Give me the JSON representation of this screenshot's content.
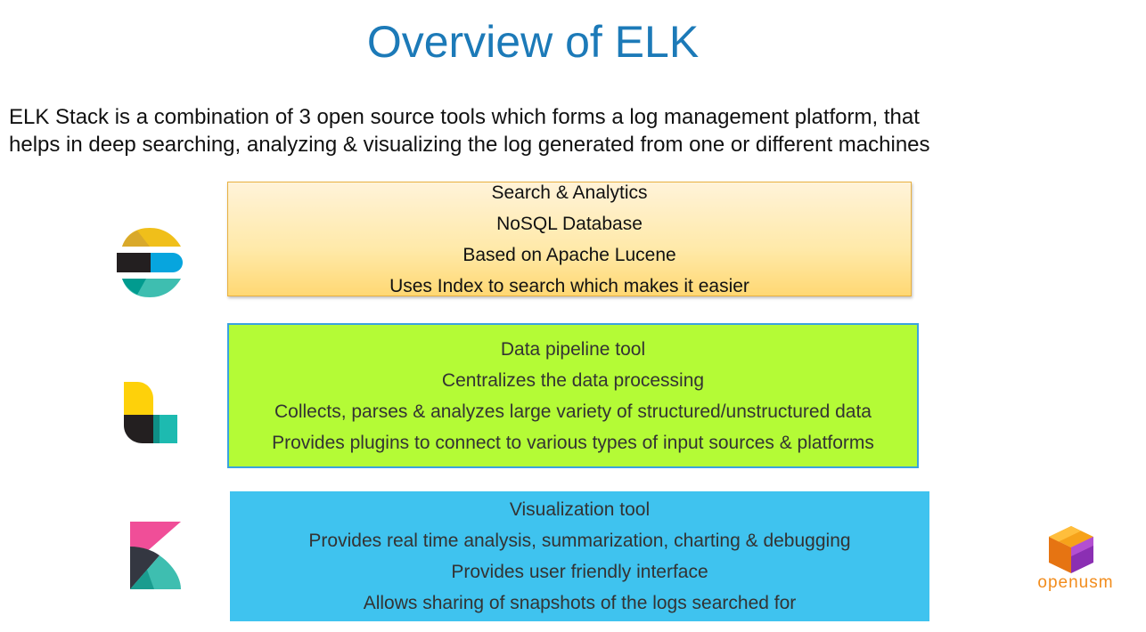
{
  "slide": {
    "title": "Overview of ELK",
    "intro_lines": [
      "ELK Stack is a combination of 3 open source tools which forms a log management platform, that",
      "helps in deep searching, analyzing & visualizing the log generated from one or different machines"
    ]
  },
  "elasticsearch": {
    "icon": "elasticsearch-logo-icon",
    "features": [
      "Search & Analytics",
      "NoSQL Database",
      "Based on Apache Lucene",
      "Uses Index to search which makes it easier"
    ]
  },
  "logstash": {
    "icon": "logstash-logo-icon",
    "features": [
      "Data pipeline tool",
      "Centralizes the data processing",
      "Collects, parses & analyzes large variety of structured/unstructured data",
      "Provides plugins to connect to various types of input sources & platforms"
    ]
  },
  "kibana": {
    "icon": "kibana-logo-icon",
    "features": [
      "Visualization tool",
      "Provides real time analysis, summarization, charting & debugging",
      "Provides user friendly interface",
      "Allows sharing of snapshots of the logs searched for"
    ]
  },
  "brand": {
    "icon": "openusm-cube-logo-icon",
    "name": "openusm"
  },
  "colors": {
    "title": "#1c7ab8",
    "logstash_box": "#b4fb36",
    "kibana_box": "#3fc3ef",
    "brand": "#f28c1c"
  }
}
